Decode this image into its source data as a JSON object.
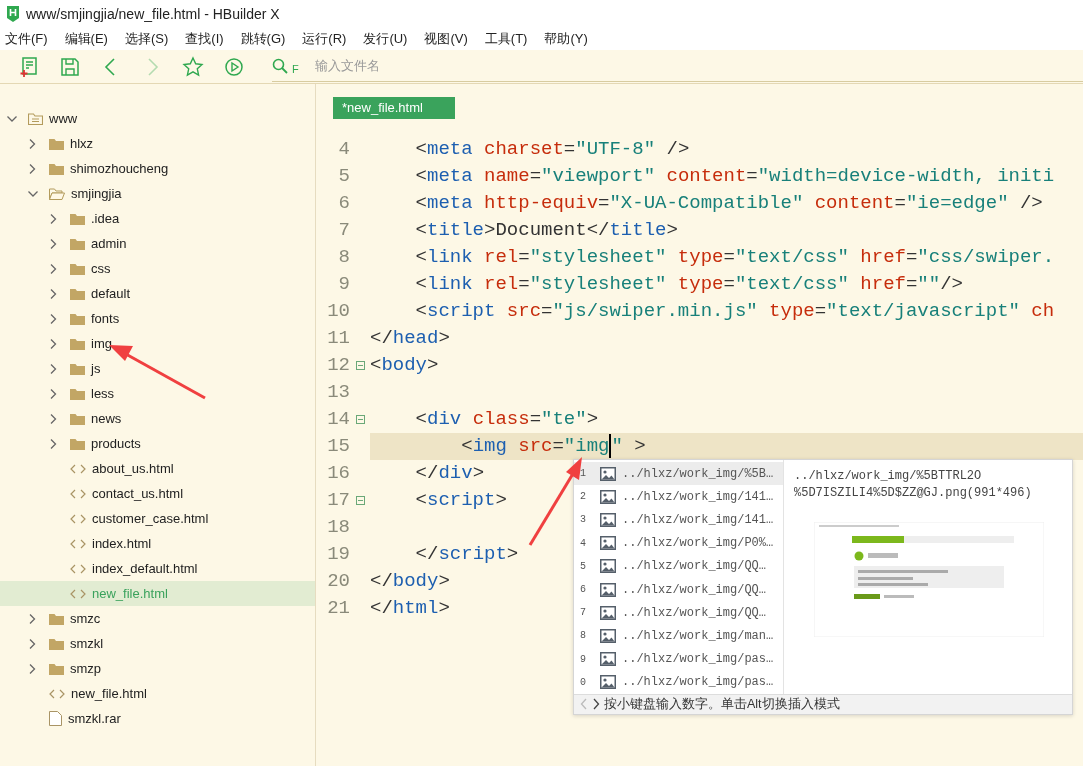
{
  "window": {
    "title": "www/smjingjia/new_file.html - HBuilder X"
  },
  "menu": [
    "文件(F)",
    "编辑(E)",
    "选择(S)",
    "查找(I)",
    "跳转(G)",
    "运行(R)",
    "发行(U)",
    "视图(V)",
    "工具(T)",
    "帮助(Y)"
  ],
  "toolbar": {
    "buttons": [
      {
        "kind": "new",
        "disabled": false
      },
      {
        "kind": "save",
        "disabled": false
      },
      {
        "kind": "back",
        "disabled": false
      },
      {
        "kind": "forward",
        "disabled": true
      },
      {
        "kind": "star",
        "disabled": false
      },
      {
        "kind": "run",
        "disabled": false
      }
    ],
    "search_mode": "F",
    "search_placeholder": "输入文件名"
  },
  "tree": [
    {
      "label": "www",
      "kind": "root",
      "expanded": true,
      "selected": false,
      "children": [
        {
          "label": "hlxz",
          "kind": "folder",
          "expanded": false,
          "selected": false
        },
        {
          "label": "shimozhoucheng",
          "kind": "folder",
          "expanded": false,
          "selected": false
        },
        {
          "label": "smjingjia",
          "kind": "folder",
          "expanded": true,
          "selected": false,
          "children": [
            {
              "label": ".idea",
              "kind": "folder",
              "expanded": false,
              "selected": false
            },
            {
              "label": "admin",
              "kind": "folder",
              "expanded": false,
              "selected": false
            },
            {
              "label": "css",
              "kind": "folder",
              "expanded": false,
              "selected": false
            },
            {
              "label": "default",
              "kind": "folder",
              "expanded": false,
              "selected": false
            },
            {
              "label": "fonts",
              "kind": "folder",
              "expanded": false,
              "selected": false
            },
            {
              "label": "img",
              "kind": "folder",
              "expanded": false,
              "selected": false
            },
            {
              "label": "js",
              "kind": "folder",
              "expanded": false,
              "selected": false
            },
            {
              "label": "less",
              "kind": "folder",
              "expanded": false,
              "selected": false
            },
            {
              "label": "news",
              "kind": "folder",
              "expanded": false,
              "selected": false
            },
            {
              "label": "products",
              "kind": "folder",
              "expanded": false,
              "selected": false
            },
            {
              "label": "about_us.html",
              "kind": "html",
              "selected": false
            },
            {
              "label": "contact_us.html",
              "kind": "html",
              "selected": false
            },
            {
              "label": "customer_case.html",
              "kind": "html",
              "selected": false
            },
            {
              "label": "index.html",
              "kind": "html",
              "selected": false
            },
            {
              "label": "index_default.html",
              "kind": "html",
              "selected": false
            },
            {
              "label": "new_file.html",
              "kind": "html",
              "selected": true
            }
          ]
        },
        {
          "label": "smzc",
          "kind": "folder",
          "expanded": false,
          "selected": false
        },
        {
          "label": "smzkl",
          "kind": "folder",
          "expanded": false,
          "selected": false
        },
        {
          "label": "smzp",
          "kind": "folder",
          "expanded": false,
          "selected": false
        },
        {
          "label": "new_file.html",
          "kind": "html",
          "selected": false
        },
        {
          "label": "smzkl.rar",
          "kind": "file",
          "selected": false
        }
      ]
    }
  ],
  "tabs": [
    {
      "label": "*new_file.html",
      "selected": true
    }
  ],
  "code": [
    {
      "number": "4",
      "fold": false,
      "current": false,
      "tokens": [
        {
          "kind": "punct",
          "text": "    <"
        },
        {
          "kind": "tag",
          "text": "meta"
        },
        {
          "kind": "attr",
          "text": " charset"
        },
        {
          "kind": "punct",
          "text": "="
        },
        {
          "kind": "string",
          "text": "\"UTF-8\""
        },
        {
          "kind": "punct",
          "text": " />"
        }
      ]
    },
    {
      "number": "5",
      "fold": false,
      "current": false,
      "tokens": [
        {
          "kind": "punct",
          "text": "    <"
        },
        {
          "kind": "tag",
          "text": "meta"
        },
        {
          "kind": "attr",
          "text": " name"
        },
        {
          "kind": "punct",
          "text": "="
        },
        {
          "kind": "string",
          "text": "\"viewport\""
        },
        {
          "kind": "attr",
          "text": " content"
        },
        {
          "kind": "punct",
          "text": "="
        },
        {
          "kind": "string",
          "text": "\"width=device-width, initi"
        }
      ]
    },
    {
      "number": "6",
      "fold": false,
      "current": false,
      "tokens": [
        {
          "kind": "punct",
          "text": "    <"
        },
        {
          "kind": "tag",
          "text": "meta"
        },
        {
          "kind": "attr",
          "text": " http-equiv"
        },
        {
          "kind": "punct",
          "text": "="
        },
        {
          "kind": "string",
          "text": "\"X-UA-Compatible\""
        },
        {
          "kind": "attr",
          "text": " content"
        },
        {
          "kind": "punct",
          "text": "="
        },
        {
          "kind": "string",
          "text": "\"ie=edge\""
        },
        {
          "kind": "punct",
          "text": " />"
        }
      ]
    },
    {
      "number": "7",
      "fold": false,
      "current": false,
      "tokens": [
        {
          "kind": "punct",
          "text": "    <"
        },
        {
          "kind": "tag",
          "text": "title"
        },
        {
          "kind": "punct",
          "text": ">Document</"
        },
        {
          "kind": "tag",
          "text": "title"
        },
        {
          "kind": "punct",
          "text": ">"
        }
      ]
    },
    {
      "number": "8",
      "fold": false,
      "current": false,
      "tokens": [
        {
          "kind": "punct",
          "text": "    <"
        },
        {
          "kind": "tag",
          "text": "link"
        },
        {
          "kind": "attr",
          "text": " rel"
        },
        {
          "kind": "punct",
          "text": "="
        },
        {
          "kind": "string",
          "text": "\"stylesheet\""
        },
        {
          "kind": "attr",
          "text": " type"
        },
        {
          "kind": "punct",
          "text": "="
        },
        {
          "kind": "string",
          "text": "\"text/css\""
        },
        {
          "kind": "attr",
          "text": " href"
        },
        {
          "kind": "punct",
          "text": "="
        },
        {
          "kind": "string",
          "text": "\"css/swiper."
        }
      ]
    },
    {
      "number": "9",
      "fold": false,
      "current": false,
      "tokens": [
        {
          "kind": "punct",
          "text": "    <"
        },
        {
          "kind": "tag",
          "text": "link"
        },
        {
          "kind": "attr",
          "text": " rel"
        },
        {
          "kind": "punct",
          "text": "="
        },
        {
          "kind": "string",
          "text": "\"stylesheet\""
        },
        {
          "kind": "attr",
          "text": " type"
        },
        {
          "kind": "punct",
          "text": "="
        },
        {
          "kind": "string",
          "text": "\"text/css\""
        },
        {
          "kind": "attr",
          "text": " href"
        },
        {
          "kind": "punct",
          "text": "="
        },
        {
          "kind": "string",
          "text": "\"\""
        },
        {
          "kind": "punct",
          "text": "/>"
        }
      ]
    },
    {
      "number": "10",
      "fold": false,
      "current": false,
      "tokens": [
        {
          "kind": "punct",
          "text": "    <"
        },
        {
          "kind": "tag",
          "text": "script"
        },
        {
          "kind": "attr",
          "text": " src"
        },
        {
          "kind": "punct",
          "text": "="
        },
        {
          "kind": "string",
          "text": "\"js/swiper.min.js\""
        },
        {
          "kind": "attr",
          "text": " type"
        },
        {
          "kind": "punct",
          "text": "="
        },
        {
          "kind": "string",
          "text": "\"text/javascript\""
        },
        {
          "kind": "attr",
          "text": " ch"
        }
      ]
    },
    {
      "number": "11",
      "fold": false,
      "current": false,
      "tokens": [
        {
          "kind": "punct",
          "text": "</"
        },
        {
          "kind": "tag",
          "text": "head"
        },
        {
          "kind": "punct",
          "text": ">"
        }
      ]
    },
    {
      "number": "12",
      "fold": true,
      "current": false,
      "tokens": [
        {
          "kind": "punct",
          "text": "<"
        },
        {
          "kind": "tag",
          "text": "body"
        },
        {
          "kind": "punct",
          "text": ">"
        }
      ]
    },
    {
      "number": "13",
      "fold": false,
      "current": false
    },
    {
      "number": "14",
      "fold": true,
      "current": false,
      "tokens": [
        {
          "kind": "punct",
          "text": "    <"
        },
        {
          "kind": "tag",
          "text": "div"
        },
        {
          "kind": "attr",
          "text": " class"
        },
        {
          "kind": "punct",
          "text": "="
        },
        {
          "kind": "string",
          "text": "\"te\""
        },
        {
          "kind": "punct",
          "text": ">"
        }
      ]
    },
    {
      "number": "15",
      "fold": false,
      "current": true,
      "tokens": [
        {
          "kind": "punct",
          "text": "        <"
        },
        {
          "kind": "tag",
          "text": "img"
        },
        {
          "kind": "attr",
          "text": " src"
        },
        {
          "kind": "punct",
          "text": "="
        },
        {
          "kind": "string",
          "text": "\"img"
        },
        {
          "kind": "cursor"
        },
        {
          "kind": "string",
          "text": "\""
        },
        {
          "kind": "punct",
          "text": " >"
        }
      ]
    },
    {
      "number": "16",
      "fold": false,
      "current": false,
      "tokens": [
        {
          "kind": "punct",
          "text": "    </"
        },
        {
          "kind": "tag",
          "text": "div"
        },
        {
          "kind": "punct",
          "text": ">"
        }
      ]
    },
    {
      "number": "17",
      "fold": true,
      "current": false,
      "tokens": [
        {
          "kind": "punct",
          "text": "    <"
        },
        {
          "kind": "tag",
          "text": "script"
        },
        {
          "kind": "punct",
          "text": ">"
        }
      ]
    },
    {
      "number": "18",
      "fold": false,
      "current": false
    },
    {
      "number": "19",
      "fold": false,
      "current": false,
      "tokens": [
        {
          "kind": "punct",
          "text": "    </"
        },
        {
          "kind": "tag",
          "text": "script"
        },
        {
          "kind": "punct",
          "text": ">"
        }
      ]
    },
    {
      "number": "20",
      "fold": false,
      "current": false,
      "tokens": [
        {
          "kind": "punct",
          "text": "</"
        },
        {
          "kind": "tag",
          "text": "body"
        },
        {
          "kind": "punct",
          "text": ">"
        }
      ]
    },
    {
      "number": "21",
      "fold": false,
      "current": false,
      "tokens": [
        {
          "kind": "punct",
          "text": "</"
        },
        {
          "kind": "tag",
          "text": "html"
        },
        {
          "kind": "punct",
          "text": ">"
        }
      ]
    }
  ],
  "completion": {
    "items": [
      {
        "index": "1",
        "text": "../hlxz/work_img/%5B…",
        "selected": true
      },
      {
        "index": "2",
        "text": "../hlxz/work_img/141…",
        "selected": false
      },
      {
        "index": "3",
        "text": "../hlxz/work_img/141…",
        "selected": false
      },
      {
        "index": "4",
        "text": "../hlxz/work_img/P0%…",
        "selected": false
      },
      {
        "index": "5",
        "text": "../hlxz/work_img/QQ…",
        "selected": false
      },
      {
        "index": "6",
        "text": "../hlxz/work_img/QQ…",
        "selected": false
      },
      {
        "index": "7",
        "text": "../hlxz/work_img/QQ…",
        "selected": false
      },
      {
        "index": "8",
        "text": "../hlxz/work_img/man…",
        "selected": false
      },
      {
        "index": "9",
        "text": "../hlxz/work_img/pas…",
        "selected": false
      },
      {
        "index": "0",
        "text": "../hlxz/work_img/pas…",
        "selected": false
      }
    ],
    "preview_lines": [
      "../hlxz/work_img/%5BTTRL2O",
      "%5D7ISZILI4%5D$ZZ@GJ.png(991*496)"
    ],
    "preview": {
      "kind": "picture"
    },
    "footer": {
      "prev_disabled": true,
      "next_disabled": false,
      "hint": "按小键盘输入数字。单击Alt切换插入模式"
    }
  }
}
